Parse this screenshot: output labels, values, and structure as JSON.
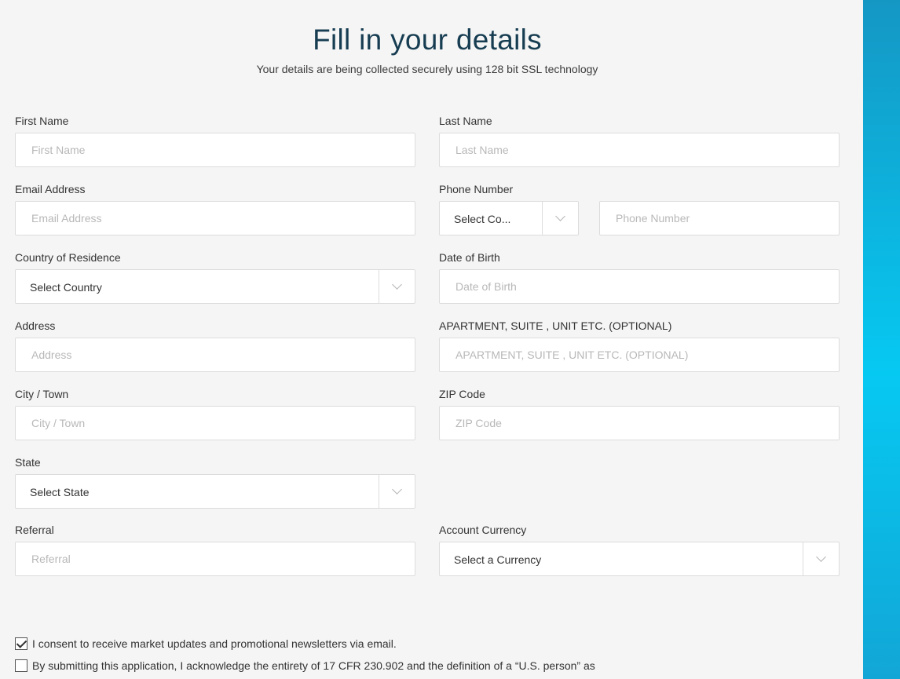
{
  "header": {
    "title": "Fill in your details",
    "subtitle": "Your details are being collected securely using 128 bit SSL technology"
  },
  "form": {
    "first_name": {
      "label": "First Name",
      "placeholder": "First Name"
    },
    "last_name": {
      "label": "Last Name",
      "placeholder": "Last Name"
    },
    "email": {
      "label": "Email Address",
      "placeholder": "Email Address"
    },
    "phone": {
      "label": "Phone Number",
      "country_code_selected": "Select Co...",
      "placeholder": "Phone Number"
    },
    "country": {
      "label": "Country of Residence",
      "selected": "Select Country"
    },
    "dob": {
      "label": "Date of Birth",
      "placeholder": "Date of Birth"
    },
    "address": {
      "label": "Address",
      "placeholder": "Address"
    },
    "apartment": {
      "label": "APARTMENT, SUITE , UNIT ETC. (OPTIONAL)",
      "placeholder": "APARTMENT, SUITE , UNIT ETC. (OPTIONAL)"
    },
    "city": {
      "label": "City / Town",
      "placeholder": "City / Town"
    },
    "zip": {
      "label": "ZIP Code",
      "placeholder": "ZIP Code"
    },
    "state": {
      "label": "State",
      "selected": "Select State"
    },
    "referral": {
      "label": "Referral",
      "placeholder": "Referral"
    },
    "currency": {
      "label": "Account Currency",
      "selected": "Select a Currency"
    }
  },
  "consents": {
    "newsletter": {
      "checked": true,
      "text": "I consent to receive market updates and promotional newsletters via email."
    },
    "us_person": {
      "checked": false,
      "text": "By submitting this application, I acknowledge the entirety of 17 CFR 230.902 and the definition of a “U.S. person” as"
    }
  },
  "colors": {
    "title": "#173d52",
    "side_strip_top": "#1597c4",
    "side_strip_mid": "#06c9f2"
  }
}
